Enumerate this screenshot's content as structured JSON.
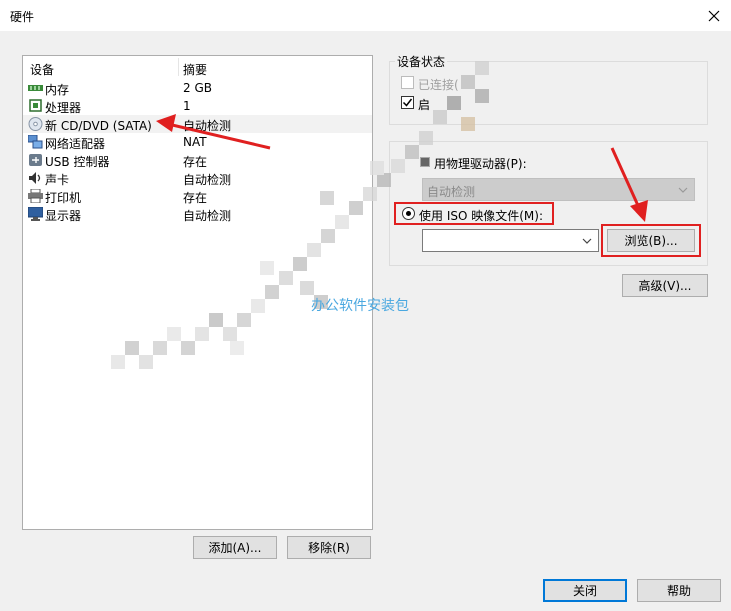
{
  "window": {
    "title": "硬件"
  },
  "device_list": {
    "headers": {
      "device": "设备",
      "summary": "摘要"
    },
    "rows": [
      {
        "icon": "memory-icon",
        "name": "内存",
        "summary": "2 GB"
      },
      {
        "icon": "cpu-icon",
        "name": "处理器",
        "summary": "1"
      },
      {
        "icon": "cd-dvd-icon",
        "name": "新 CD/DVD (SATA)",
        "summary": "自动检测"
      },
      {
        "icon": "network-adapter-icon",
        "name": "网络适配器",
        "summary": "NAT"
      },
      {
        "icon": "usb-icon",
        "name": "USB 控制器",
        "summary": "存在"
      },
      {
        "icon": "sound-card-icon",
        "name": "声卡",
        "summary": "自动检测"
      },
      {
        "icon": "printer-icon",
        "name": "打印机",
        "summary": "存在"
      },
      {
        "icon": "display-icon",
        "name": "显示器",
        "summary": "自动检测"
      }
    ]
  },
  "buttons": {
    "add": "添加(A)...",
    "remove": "移除(R)",
    "browse": "浏览(B)...",
    "advanced": "高级(V)...",
    "close": "关闭",
    "help": "帮助"
  },
  "device_status": {
    "label": "设备状态",
    "connected": "已连接(",
    "power_on": "启"
  },
  "connection": {
    "physical": "用物理驱动器(P):",
    "physical_value": "自动检测",
    "iso": "使用 ISO 映像文件(M):",
    "iso_value": ""
  },
  "watermark": "办公软件安装包",
  "colors": {
    "annotation_red": "#e02020",
    "accent": "#0078d7",
    "watermark": "#4aa8e0"
  }
}
